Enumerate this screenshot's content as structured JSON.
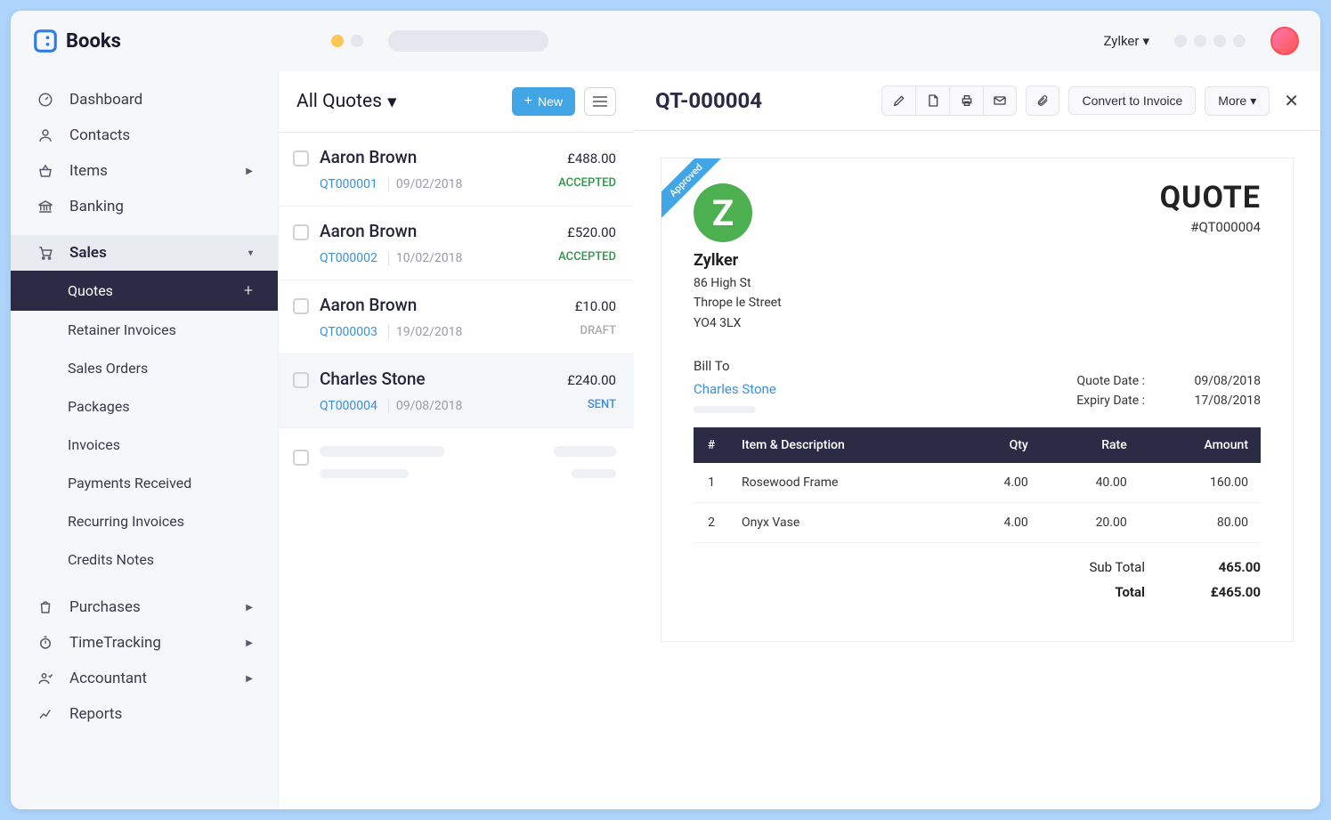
{
  "app_name": "Books",
  "org": "Zylker",
  "sidebar": {
    "items": [
      {
        "label": "Dashboard"
      },
      {
        "label": "Contacts"
      },
      {
        "label": "Items"
      },
      {
        "label": "Banking"
      }
    ],
    "sales_label": "Sales",
    "sales_sub": [
      {
        "label": "Quotes",
        "active": true
      },
      {
        "label": "Retainer Invoices"
      },
      {
        "label": "Sales Orders"
      },
      {
        "label": "Packages"
      },
      {
        "label": "Invoices"
      },
      {
        "label": "Payments Received"
      },
      {
        "label": "Recurring Invoices"
      },
      {
        "label": "Credits Notes"
      }
    ],
    "bottom": [
      {
        "label": "Purchases"
      },
      {
        "label": "TimeTracking"
      },
      {
        "label": "Accountant"
      },
      {
        "label": "Reports"
      }
    ]
  },
  "list": {
    "title": "All Quotes",
    "new_label": "New",
    "rows": [
      {
        "name": "Aaron Brown",
        "amount": "£488.00",
        "id": "QT000001",
        "date": "09/02/2018",
        "status": "ACCEPTED",
        "status_class": "accepted"
      },
      {
        "name": "Aaron Brown",
        "amount": "£520.00",
        "id": "QT000002",
        "date": "10/02/2018",
        "status": "ACCEPTED",
        "status_class": "accepted"
      },
      {
        "name": "Aaron Brown",
        "amount": "£10.00",
        "id": "QT000003",
        "date": "19/02/2018",
        "status": "DRAFT",
        "status_class": "draft"
      },
      {
        "name": "Charles Stone",
        "amount": "£240.00",
        "id": "QT000004",
        "date": "09/08/2018",
        "status": "SENT",
        "status_class": "sent",
        "selected": true
      }
    ]
  },
  "detail": {
    "header_title": "QT-000004",
    "convert_label": "Convert to Invoice",
    "more_label": "More",
    "ribbon": "Approved",
    "company": {
      "name": "Zylker",
      "addr1": "86 High St",
      "addr2": "Thrope le Street",
      "addr3": "YO4 3LX"
    },
    "doc_title": "QUOTE",
    "doc_number": "#QT000004",
    "bill_to_label": "Bill To",
    "bill_to_name": "Charles Stone",
    "dates": {
      "quote_date_label": "Quote Date :",
      "quote_date": "09/08/2018",
      "expiry_date_label": "Expiry Date :",
      "expiry_date": "17/08/2018"
    },
    "col_hash": "#",
    "col_item": "Item & Description",
    "col_qty": "Qty",
    "col_rate": "Rate",
    "col_amount": "Amount",
    "items": [
      {
        "n": "1",
        "desc": "Rosewood Frame",
        "qty": "4.00",
        "rate": "40.00",
        "amount": "160.00"
      },
      {
        "n": "2",
        "desc": "Onyx Vase",
        "qty": "4.00",
        "rate": "20.00",
        "amount": "80.00"
      }
    ],
    "subtotal_label": "Sub Total",
    "subtotal": "465.00",
    "total_label": "Total",
    "total": "£465.00"
  }
}
